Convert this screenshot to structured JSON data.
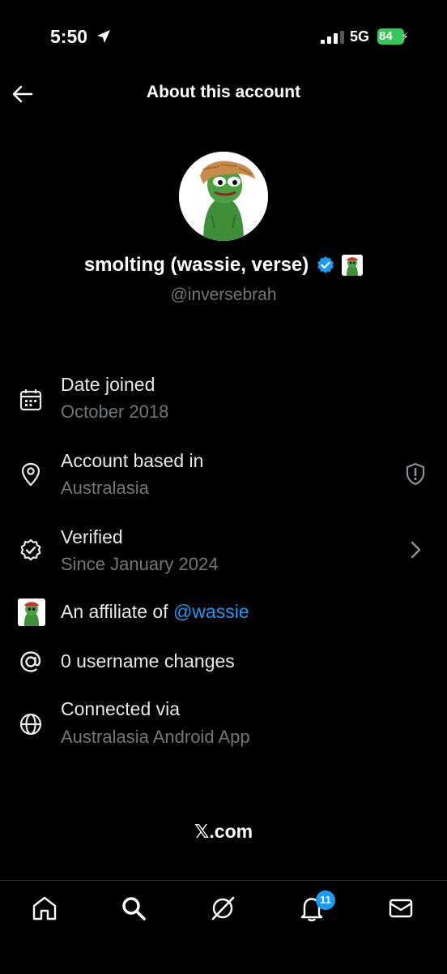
{
  "status_bar": {
    "time": "5:50",
    "network": "5G",
    "battery": "84"
  },
  "header": {
    "title": "About this account"
  },
  "profile": {
    "display_name": "smolting (wassie, verse)",
    "handle": "@inversebrah"
  },
  "info": {
    "date_joined": {
      "title": "Date joined",
      "value": "October 2018"
    },
    "based_in": {
      "title": "Account based in",
      "value": "Australasia"
    },
    "verified": {
      "title": "Verified",
      "value": "Since January 2024"
    },
    "affiliate": {
      "prefix": "An affiliate of ",
      "link": "@wassie"
    },
    "username_changes": {
      "title": "0 username changes"
    },
    "connected_via": {
      "title": "Connected via",
      "value": "Australasia Android App"
    }
  },
  "footer": {
    "brand": "𝕏.com"
  },
  "tab_bar": {
    "items": [
      "home-icon",
      "search-icon",
      "grok-icon",
      "notifications-icon",
      "messages-icon"
    ],
    "notification_count": "11"
  },
  "colors": {
    "accent": "#1d9bf0",
    "muted": "#71767b",
    "battery": "#34c759"
  }
}
